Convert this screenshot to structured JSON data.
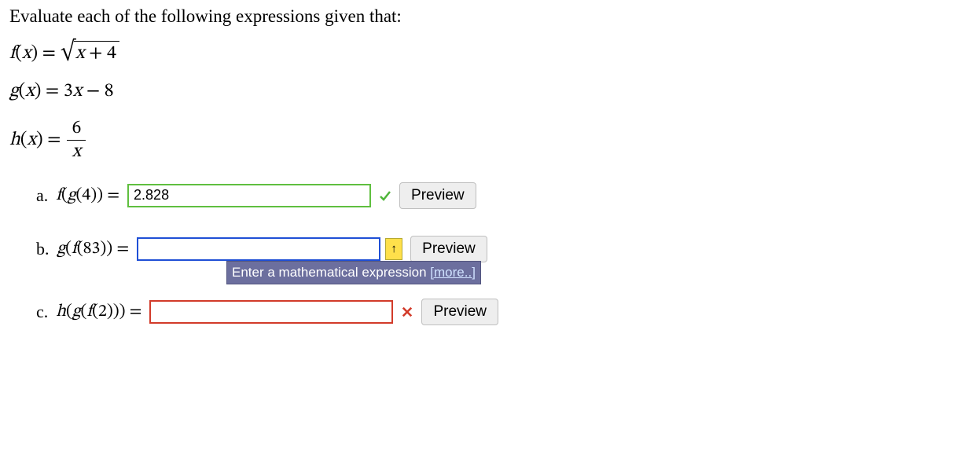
{
  "prompt": "Evaluate each of the following expressions given that:",
  "functions": {
    "f_lhs": "f(x) = ",
    "f_radicand": "x + 4",
    "g_text": "g(x) = 3x − 8",
    "h_lhs": "h(x) = ",
    "h_num": "6",
    "h_den": "x"
  },
  "questions": {
    "a": {
      "label": "a. ",
      "expr": "f(g(4)) = ",
      "value": "2.828",
      "status": "correct"
    },
    "b": {
      "label": "b. ",
      "expr": "g(f(83)) = ",
      "value": "",
      "status": "active",
      "caret": "↑"
    },
    "c": {
      "label": "c. ",
      "expr": "h(g(f(2))) = ",
      "value": "",
      "status": "wrong"
    }
  },
  "tooltip": {
    "text": "Enter a mathematical expression ",
    "more": "[more..]"
  },
  "buttons": {
    "preview": "Preview"
  }
}
